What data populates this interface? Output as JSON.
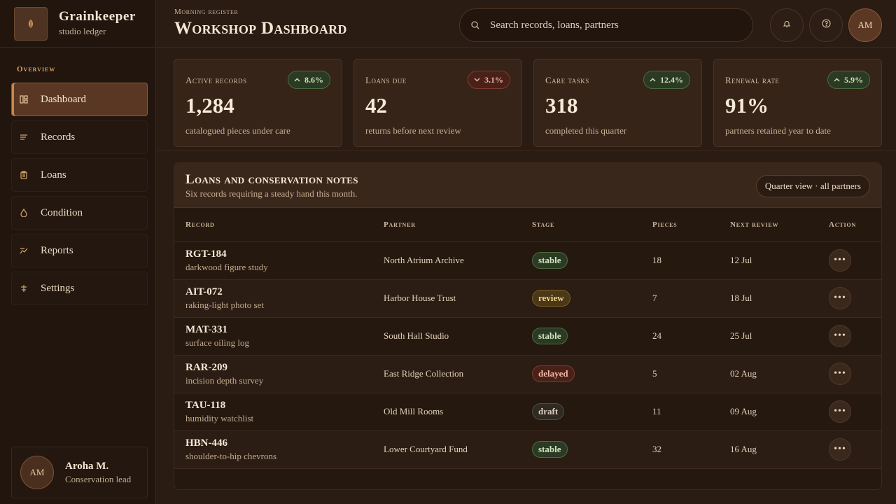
{
  "brand": {
    "name": "Grainkeeper",
    "subtitle": "studio ledger"
  },
  "sidebar": {
    "section_label": "Overview",
    "items": [
      {
        "label": "Dashboard",
        "icon": "dashboard-icon",
        "active": true
      },
      {
        "label": "Records",
        "icon": "records-icon",
        "active": false
      },
      {
        "label": "Loans",
        "icon": "clipboard-icon",
        "active": false
      },
      {
        "label": "Condition",
        "icon": "droplet-icon",
        "active": false
      },
      {
        "label": "Reports",
        "icon": "trend-icon",
        "active": false
      },
      {
        "label": "Settings",
        "icon": "sliders-icon",
        "active": false
      }
    ],
    "profile": {
      "initials": "AM",
      "name": "Aroha M.",
      "role": "Conservation lead"
    }
  },
  "header": {
    "eyebrow": "Morning register",
    "title": "Workshop Dashboard",
    "search_placeholder": "Search records, loans, partners",
    "avatar_initials": "AM"
  },
  "kpis": [
    {
      "label": "Active records",
      "value": "1,284",
      "caption": "catalogued pieces under care",
      "delta": "8.6%",
      "trend": "up"
    },
    {
      "label": "Loans due",
      "value": "42",
      "caption": "returns before next review",
      "delta": "3.1%",
      "trend": "down"
    },
    {
      "label": "Care tasks",
      "value": "318",
      "caption": "completed this quarter",
      "delta": "12.4%",
      "trend": "up"
    },
    {
      "label": "Renewal rate",
      "value": "91%",
      "caption": "partners retained year to date",
      "delta": "5.9%",
      "trend": "up"
    }
  ],
  "table": {
    "title": "Loans and conservation notes",
    "subtitle": "Six records requiring a steady hand this month.",
    "view_button": "Quarter view · all partners",
    "columns": [
      "Record",
      "Partner",
      "Stage",
      "Pieces",
      "Next review",
      "Action"
    ],
    "rows": [
      {
        "id": "RGT-184",
        "desc": "darkwood figure study",
        "partner": "North Atrium Archive",
        "stage": "stable",
        "pieces": "18",
        "review": "12 Jul"
      },
      {
        "id": "AIT-072",
        "desc": "raking-light photo set",
        "partner": "Harbor House Trust",
        "stage": "review",
        "pieces": "7",
        "review": "18 Jul"
      },
      {
        "id": "MAT-331",
        "desc": "surface oiling log",
        "partner": "South Hall Studio",
        "stage": "stable",
        "pieces": "24",
        "review": "25 Jul"
      },
      {
        "id": "RAR-209",
        "desc": "incision depth survey",
        "partner": "East Ridge Collection",
        "stage": "delayed",
        "pieces": "5",
        "review": "02 Aug"
      },
      {
        "id": "TAU-118",
        "desc": "humidity watchlist",
        "partner": "Old Mill Rooms",
        "stage": "draft",
        "pieces": "11",
        "review": "09 Aug"
      },
      {
        "id": "HBN-446",
        "desc": "shoulder-to-hip chevrons",
        "partner": "Lower Courtyard Fund",
        "stage": "stable",
        "pieces": "32",
        "review": "16 Aug"
      }
    ],
    "action_glyph": "•••"
  },
  "colors": {
    "accent": "#c98a4b",
    "background": "#2a1b13",
    "sidebar": "#21150e",
    "positive": "#c9e1b4",
    "negative": "#eab4a2"
  }
}
